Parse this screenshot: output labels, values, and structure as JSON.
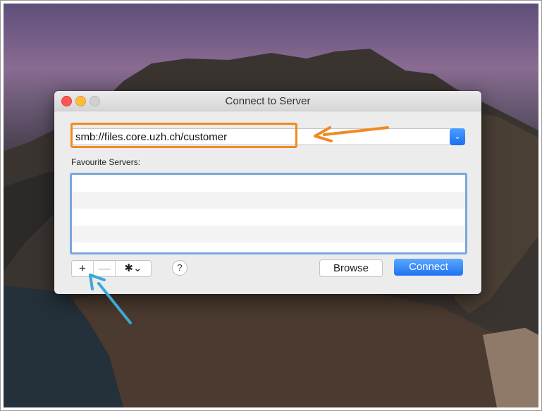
{
  "window": {
    "title": "Connect to Server"
  },
  "server_address": {
    "value": "smb://files.core.uzh.ch/customer",
    "dropdown_glyph": "⌄"
  },
  "favourites": {
    "label": "Favourite Servers:",
    "rows": [
      "",
      "",
      "",
      ""
    ]
  },
  "toolbar": {
    "add_glyph": "+",
    "remove_glyph": "—",
    "gear_glyph": "✱⌄",
    "help_glyph": "?"
  },
  "buttons": {
    "browse_label": "Browse",
    "connect_label": "Connect"
  },
  "colors": {
    "orange_annotation": "#f08a24",
    "blue_annotation": "#3aa8d8",
    "accent": "#1f72f2"
  },
  "icons": {
    "close": "close-icon",
    "minimize": "minimize-icon",
    "zoom": "zoom-icon",
    "add": "plus-icon",
    "remove": "minus-icon",
    "gear": "gear-icon",
    "help": "help-icon",
    "dropdown": "chevron-down-icon"
  }
}
